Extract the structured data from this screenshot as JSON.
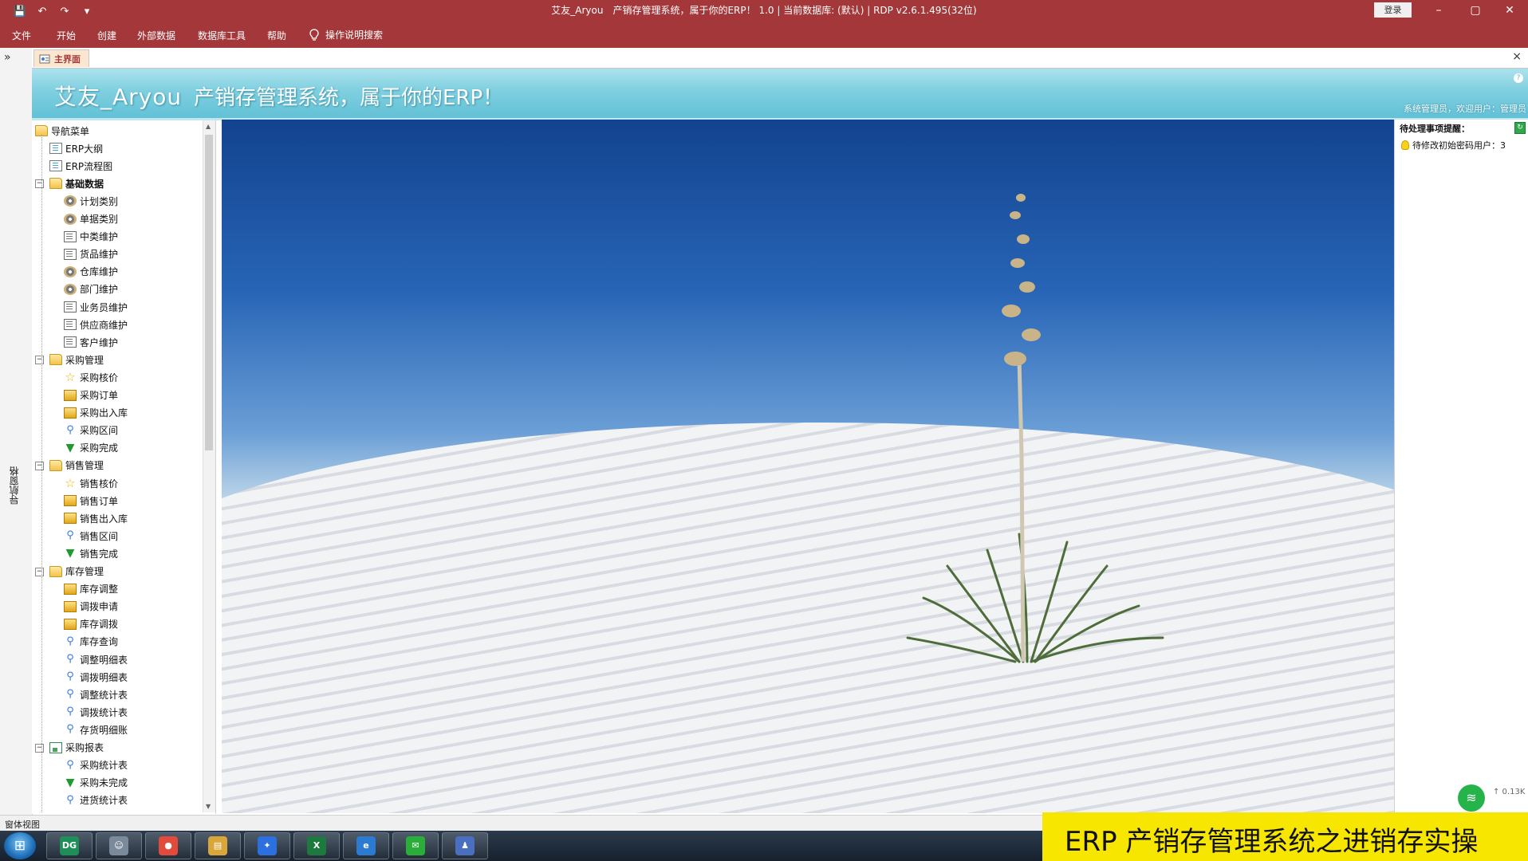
{
  "window": {
    "title": "艾友_Aryou　产销存管理系统，属于你的ERP！ 1.0 | 当前数据库: (默认) | RDP v2.6.1.495(32位)",
    "login_label": "登录",
    "controls": {
      "minimize": "–",
      "restore": "▢",
      "close": "✕"
    },
    "quick_access": {
      "save": "💾",
      "undo": "↶",
      "redo": "↷",
      "more": "▾"
    }
  },
  "menu": {
    "items": [
      "文件",
      "开始",
      "创建",
      "外部数据",
      "数据库工具",
      "帮助"
    ],
    "tell_me": "操作说明搜索",
    "tell_me_icon": "lightbulb-icon"
  },
  "nav_pane": {
    "collapse_glyph": "»",
    "vertical_label": "导航窗格"
  },
  "tab": {
    "label": "主界面",
    "close_glyph": "×"
  },
  "banner": {
    "brand": "艾友_Aryou",
    "subtitle": "产销存管理系统，属于你的ERP！",
    "links": "系统管理员，欢迎用户：管理员",
    "help": "?"
  },
  "nav_tree": {
    "items": [
      {
        "label": "导航菜单",
        "icon": "folder-open-icon",
        "level": 0,
        "expander": "",
        "bold": false
      },
      {
        "label": "ERP大纲",
        "icon": "book-icon",
        "level": 1,
        "expander": "",
        "bold": false
      },
      {
        "label": "ERP流程图",
        "icon": "book-icon",
        "level": 1,
        "expander": "",
        "bold": false
      },
      {
        "label": "基础数据",
        "icon": "folder-open-icon",
        "level": 1,
        "expander": "−",
        "bold": true
      },
      {
        "label": "计划类别",
        "icon": "gear-icon",
        "level": 2,
        "expander": "",
        "bold": false
      },
      {
        "label": "单据类别",
        "icon": "gear-icon",
        "level": 2,
        "expander": "",
        "bold": false
      },
      {
        "label": "中类维护",
        "icon": "document-icon",
        "level": 2,
        "expander": "",
        "bold": false
      },
      {
        "label": "货品维护",
        "icon": "document-icon",
        "level": 2,
        "expander": "",
        "bold": false
      },
      {
        "label": "仓库维护",
        "icon": "gear-icon",
        "level": 2,
        "expander": "",
        "bold": false
      },
      {
        "label": "部门维护",
        "icon": "gear-icon",
        "level": 2,
        "expander": "",
        "bold": false
      },
      {
        "label": "业务员维护",
        "icon": "document-icon",
        "level": 2,
        "expander": "",
        "bold": false
      },
      {
        "label": "供应商维护",
        "icon": "document-icon",
        "level": 2,
        "expander": "",
        "bold": false
      },
      {
        "label": "客户维护",
        "icon": "document-icon",
        "level": 2,
        "expander": "",
        "bold": false
      },
      {
        "label": "采购管理",
        "icon": "folder-open-icon",
        "level": 1,
        "expander": "−",
        "bold": false
      },
      {
        "label": "采购核价",
        "icon": "star-icon",
        "level": 2,
        "expander": "",
        "bold": false
      },
      {
        "label": "采购订单",
        "icon": "box-icon",
        "level": 2,
        "expander": "",
        "bold": false
      },
      {
        "label": "采购出入库",
        "icon": "box-icon",
        "level": 2,
        "expander": "",
        "bold": false
      },
      {
        "label": "采购区间",
        "icon": "search-icon",
        "level": 2,
        "expander": "",
        "bold": false
      },
      {
        "label": "采购完成",
        "icon": "funnel-icon",
        "level": 2,
        "expander": "",
        "bold": false
      },
      {
        "label": "销售管理",
        "icon": "folder-open-icon",
        "level": 1,
        "expander": "−",
        "bold": false
      },
      {
        "label": "销售核价",
        "icon": "star-icon",
        "level": 2,
        "expander": "",
        "bold": false
      },
      {
        "label": "销售订单",
        "icon": "box-icon",
        "level": 2,
        "expander": "",
        "bold": false
      },
      {
        "label": "销售出入库",
        "icon": "box-icon",
        "level": 2,
        "expander": "",
        "bold": false
      },
      {
        "label": "销售区间",
        "icon": "search-icon",
        "level": 2,
        "expander": "",
        "bold": false
      },
      {
        "label": "销售完成",
        "icon": "funnel-icon",
        "level": 2,
        "expander": "",
        "bold": false
      },
      {
        "label": "库存管理",
        "icon": "folder-open-icon",
        "level": 1,
        "expander": "−",
        "bold": false
      },
      {
        "label": "库存调整",
        "icon": "box-icon",
        "level": 2,
        "expander": "",
        "bold": false
      },
      {
        "label": "调拨申请",
        "icon": "box-icon",
        "level": 2,
        "expander": "",
        "bold": false
      },
      {
        "label": "库存调拨",
        "icon": "box-icon",
        "level": 2,
        "expander": "",
        "bold": false
      },
      {
        "label": "库存查询",
        "icon": "search-icon",
        "level": 2,
        "expander": "",
        "bold": false
      },
      {
        "label": "调整明细表",
        "icon": "search-icon",
        "level": 2,
        "expander": "",
        "bold": false
      },
      {
        "label": "调拨明细表",
        "icon": "search-icon",
        "level": 2,
        "expander": "",
        "bold": false
      },
      {
        "label": "调整统计表",
        "icon": "search-icon",
        "level": 2,
        "expander": "",
        "bold": false
      },
      {
        "label": "调拨统计表",
        "icon": "search-icon",
        "level": 2,
        "expander": "",
        "bold": false
      },
      {
        "label": "存货明细账",
        "icon": "search-icon",
        "level": 2,
        "expander": "",
        "bold": false
      },
      {
        "label": "采购报表",
        "icon": "report-icon",
        "level": 1,
        "expander": "−",
        "bold": false
      },
      {
        "label": "采购统计表",
        "icon": "search-icon",
        "level": 2,
        "expander": "",
        "bold": false
      },
      {
        "label": "采购未完成",
        "icon": "funnel-icon",
        "level": 2,
        "expander": "",
        "bold": false
      },
      {
        "label": "进货统计表",
        "icon": "search-icon",
        "level": 2,
        "expander": "",
        "bold": false
      }
    ]
  },
  "reminders": {
    "title": "待处理事项提醒：",
    "items": [
      "待修改初始密码用户：3"
    ]
  },
  "net_widget": {
    "speed": "↑ 0.13K"
  },
  "status_bar": {
    "text": "窗体视图"
  },
  "taskbar": {
    "start_glyph": "⊞",
    "apps": [
      {
        "name": "datagrip-icon",
        "glyph": "DG",
        "color": "#1f8f5a"
      },
      {
        "name": "user-tool-icon",
        "glyph": "☺",
        "color": "#7a8a9a"
      },
      {
        "name": "chrome-icon",
        "glyph": "●",
        "color": "#e24a3b"
      },
      {
        "name": "file-explorer-icon",
        "glyph": "▤",
        "color": "#d9a63a"
      },
      {
        "name": "feishu-icon",
        "glyph": "✦",
        "color": "#2c6fe0"
      },
      {
        "name": "excel-icon",
        "glyph": "X",
        "color": "#1d7a3e"
      },
      {
        "name": "ie-icon",
        "glyph": "e",
        "color": "#2b7bd3"
      },
      {
        "name": "wechat-icon",
        "glyph": "✉",
        "color": "#2aae3a"
      },
      {
        "name": "people-icon",
        "glyph": "♟",
        "color": "#4a6fc0"
      }
    ]
  },
  "caption": {
    "text": "ERP 产销存管理系统之进销存实操"
  },
  "colors": {
    "accent": "#a4373a",
    "banner": "#7fcfe0",
    "caption_bg": "#f7e600"
  }
}
